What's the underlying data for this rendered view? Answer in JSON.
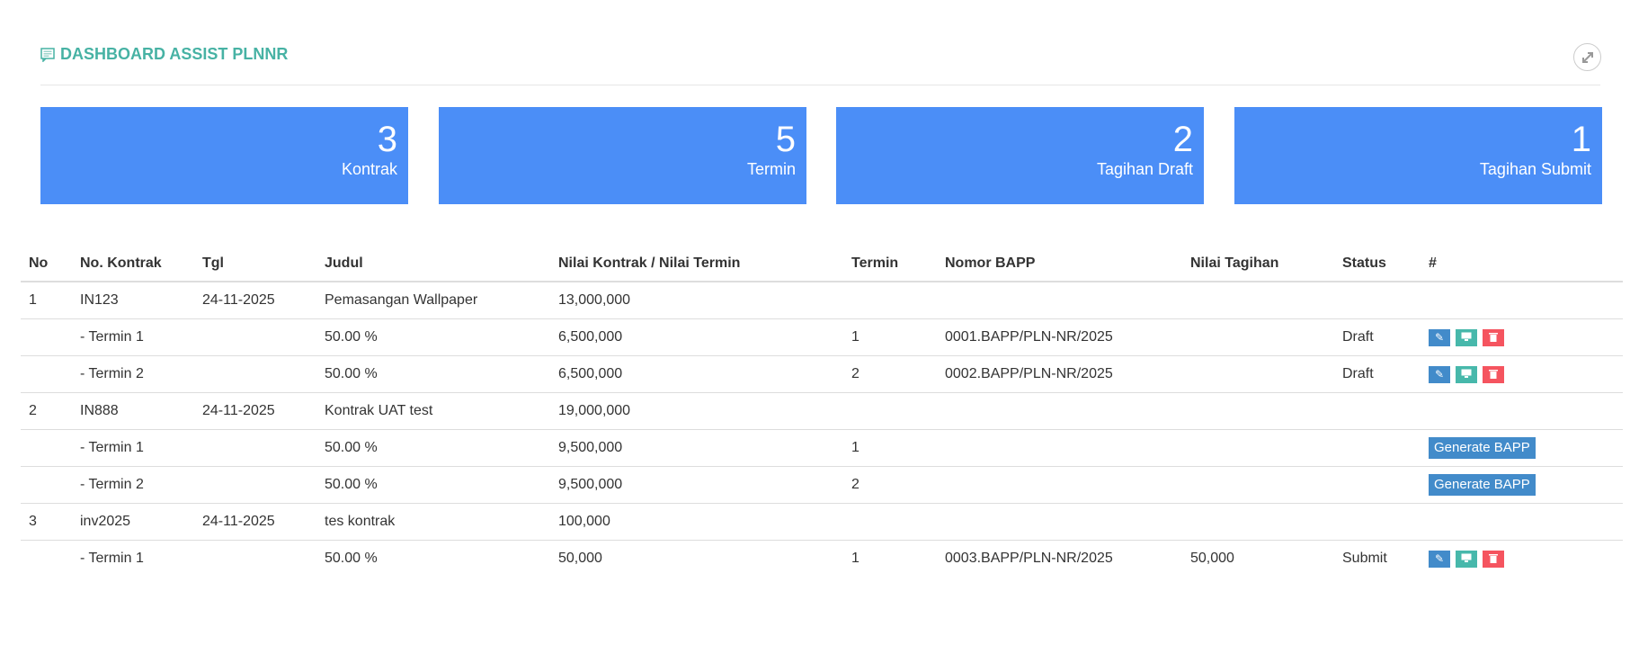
{
  "header": {
    "title": "DASHBOARD ASSIST PLNNR",
    "title_icon": "comment-icon",
    "expand_icon": "expand-icon"
  },
  "cards": [
    {
      "value": "3",
      "label": "Kontrak"
    },
    {
      "value": "5",
      "label": "Termin"
    },
    {
      "value": "2",
      "label": "Tagihan Draft"
    },
    {
      "value": "1",
      "label": "Tagihan Submit"
    }
  ],
  "table": {
    "headers": [
      "No",
      "No. Kontrak",
      "Tgl",
      "Judul",
      "Nilai Kontrak / Nilai Termin",
      "Termin",
      "Nomor BAPP",
      "Nilai Tagihan",
      "Status",
      "#"
    ],
    "generate_label": "Generate BAPP",
    "rows": [
      {
        "type": "kontrak",
        "no": "1",
        "kontrak": "IN123",
        "tgl": "24-11-2025",
        "judul": "Pemasangan Wallpaper",
        "nilai": "13,000,000",
        "termin": "",
        "bapp": "",
        "tagihan": "",
        "status": "",
        "action": "none"
      },
      {
        "type": "termin",
        "no": "",
        "kontrak": "- Termin 1",
        "tgl": "",
        "judul": "50.00 %",
        "nilai": "6,500,000",
        "termin": "1",
        "bapp": "0001.BAPP/PLN-NR/2025",
        "tagihan": "",
        "status": "Draft",
        "action": "icons"
      },
      {
        "type": "termin",
        "no": "",
        "kontrak": "- Termin 2",
        "tgl": "",
        "judul": "50.00 %",
        "nilai": "6,500,000",
        "termin": "2",
        "bapp": "0002.BAPP/PLN-NR/2025",
        "tagihan": "",
        "status": "Draft",
        "action": "icons"
      },
      {
        "type": "kontrak",
        "no": "2",
        "kontrak": "IN888",
        "tgl": "24-11-2025",
        "judul": "Kontrak UAT test",
        "nilai": "19,000,000",
        "termin": "",
        "bapp": "",
        "tagihan": "",
        "status": "",
        "action": "none"
      },
      {
        "type": "termin",
        "no": "",
        "kontrak": "- Termin 1",
        "tgl": "",
        "judul": "50.00 %",
        "nilai": "9,500,000",
        "termin": "1",
        "bapp": "",
        "tagihan": "",
        "status": "",
        "action": "generate"
      },
      {
        "type": "termin",
        "no": "",
        "kontrak": "- Termin 2",
        "tgl": "",
        "judul": "50.00 %",
        "nilai": "9,500,000",
        "termin": "2",
        "bapp": "",
        "tagihan": "",
        "status": "",
        "action": "generate"
      },
      {
        "type": "kontrak",
        "no": "3",
        "kontrak": "inv2025",
        "tgl": "24-11-2025",
        "judul": "tes kontrak",
        "nilai": "100,000",
        "termin": "",
        "bapp": "",
        "tagihan": "",
        "status": "",
        "action": "none"
      },
      {
        "type": "termin",
        "no": "",
        "kontrak": "- Termin 1",
        "tgl": "",
        "judul": "50.00 %",
        "nilai": "50,000",
        "termin": "1",
        "bapp": "0003.BAPP/PLN-NR/2025",
        "tagihan": "50,000",
        "status": "Submit",
        "action": "icons"
      }
    ]
  }
}
